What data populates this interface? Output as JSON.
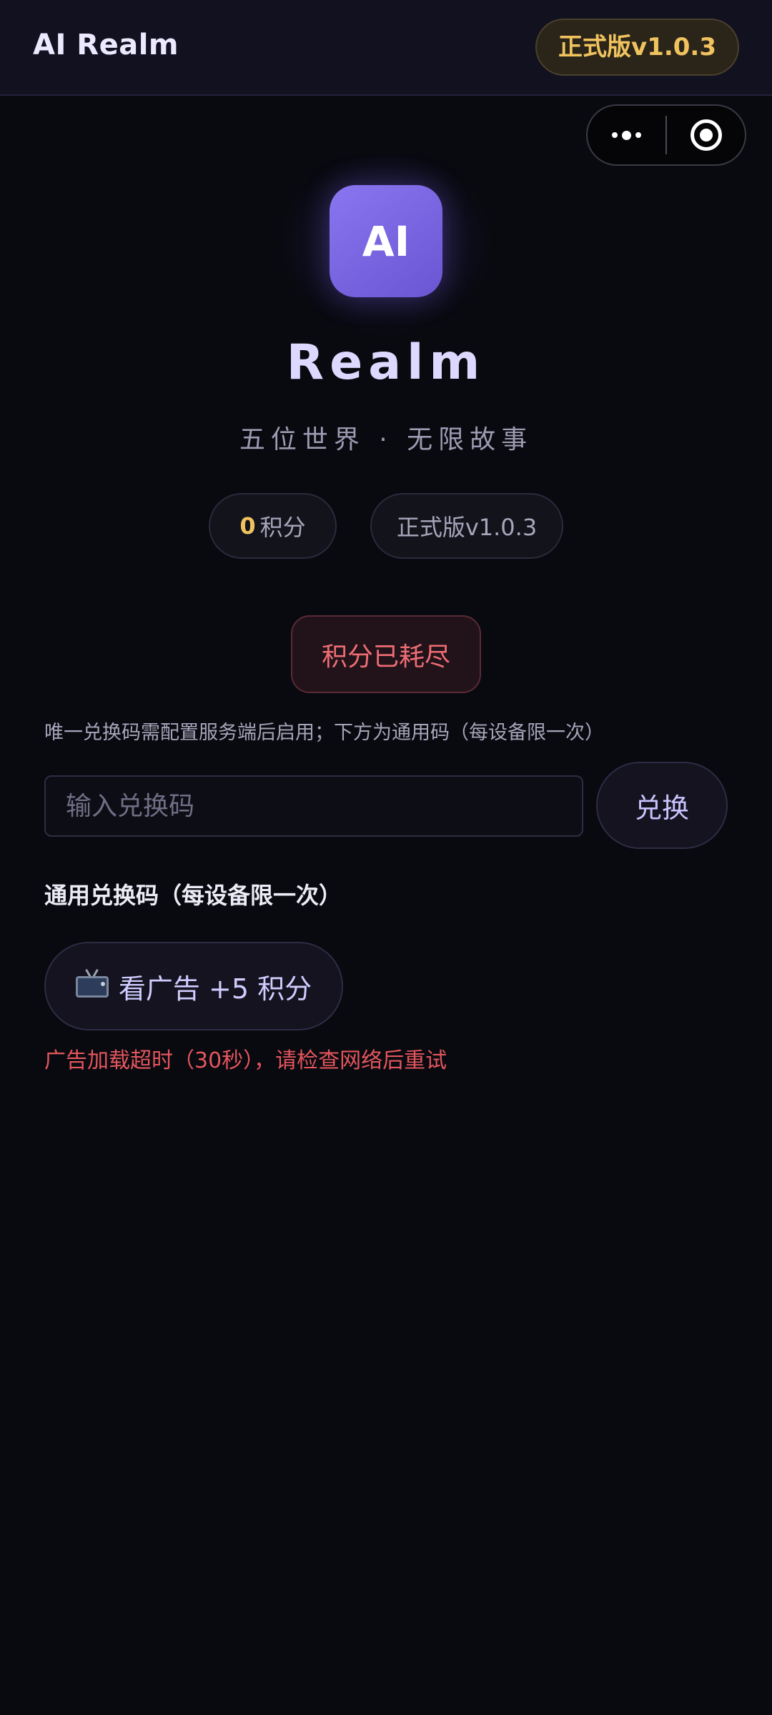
{
  "header": {
    "title": "AI Realm",
    "version_badge": "正式版v1.0.3"
  },
  "capsule": {
    "more_icon": "more-dots-icon",
    "close_icon": "target-close-icon"
  },
  "hero": {
    "logo_text": "AI",
    "app_name": "Realm",
    "tagline": "五位世界 · 无限故事"
  },
  "stats": {
    "points_value": "0",
    "points_label": "积分",
    "version": "正式版v1.0.3"
  },
  "status": {
    "exhausted_label": "积分已耗尽"
  },
  "redeem": {
    "notice": "唯一兑换码需配置服务端后启用；下方为通用码（每设备限一次）",
    "input_placeholder": "输入兑换码",
    "input_value": "",
    "button_label": "兑换"
  },
  "universal": {
    "section_title": "通用兑换码（每设备限一次）",
    "ad_button_label": "看广告 +5 积分",
    "ad_icon": "tv-icon",
    "error_message": "广告加载超时（30秒），请检查网络后重试"
  },
  "colors": {
    "background": "#090910",
    "accent_purple": "#7a66e4",
    "gold": "#f0c35f",
    "error_red": "#e3565c"
  }
}
